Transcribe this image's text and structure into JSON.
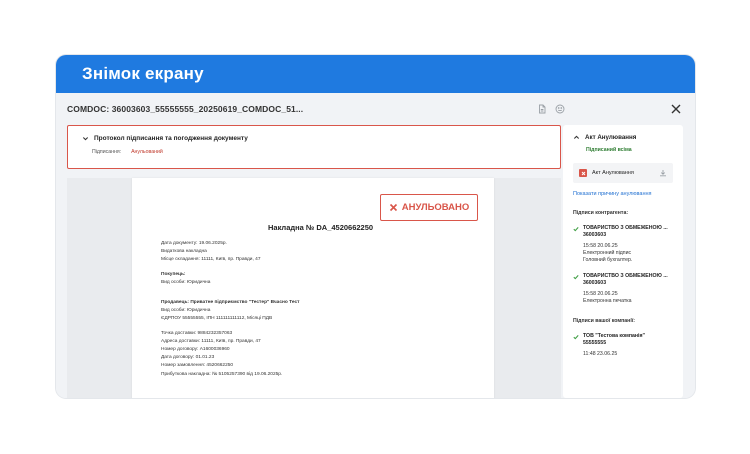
{
  "banner": {
    "title": "Знімок екрану"
  },
  "titlebar": {
    "doc_title": "COMDOC: 36003603_55555555_20250619_COMDOC_51..."
  },
  "protocol": {
    "header": "Протокол підписання та погодження документу",
    "label": "Підписання:",
    "value": "Анульований"
  },
  "document": {
    "stamp": "АНУЛЬОВАНО",
    "title": "Накладна № DA_4520662250",
    "date": "Дата документу: 19.06.2025р.",
    "type": "Видаткова накладна",
    "place": "Місце складання: 11111, Київ, пр. Правди, 47",
    "buyer_label": "Покупець:",
    "buyer_type": "Вид особи: Юридична",
    "seller_label": "Продавець: Приватне підприємство \"Тестер\" Вчасно Тест",
    "seller_type": "Вид особи: Юридична",
    "seller_codes": "ЄДРПОУ 55555555, ІПН 111111111112, Місяці ПДВ",
    "delivery_point": "Точка доставки: 9884232357063",
    "delivery_address": "Адреса доставки: 11111, Київ, пр. Правди, 47",
    "contract_no": "Номер договору: А1600036960",
    "contract_date": "Дата договору: 01.01.23",
    "order_no": "Номер замовлення: 4520662250",
    "receipt": "Прибуткова накладна: № 5105257390 від 19.06.2025р."
  },
  "panel": {
    "act_title": "Акт Анулювання",
    "act_status": "Підписаний всіма",
    "attachment": "Акт Анулювання",
    "reason_link": "Показати причину анулювання",
    "counterparty_label": "Підписи контрагента:",
    "signers": [
      {
        "name": "ТОВАРИСТВО З ОБМЕЖЕНОЮ ...",
        "code": "36003603",
        "time": "15:58 20.06.25",
        "line1": "Електронний підпис",
        "line2": "Головний бухгалтер."
      },
      {
        "name": "ТОВАРИСТВО З ОБМЕЖЕНОЮ ...",
        "code": "36003603",
        "time": "15:58 20.06.25",
        "line1": "Електронна печатка",
        "line2": ""
      }
    ],
    "company_label": "Підписи вашої компанії:",
    "own_signer": {
      "name": "ТОВ \"Тестова компанія\"",
      "code": "55555555",
      "time": "11:48 23.06.25"
    }
  },
  "colors": {
    "banner": "#1f7ae0",
    "annulled": "#d9564a",
    "signed": "#2e7d32",
    "link": "#1f6fd1"
  }
}
